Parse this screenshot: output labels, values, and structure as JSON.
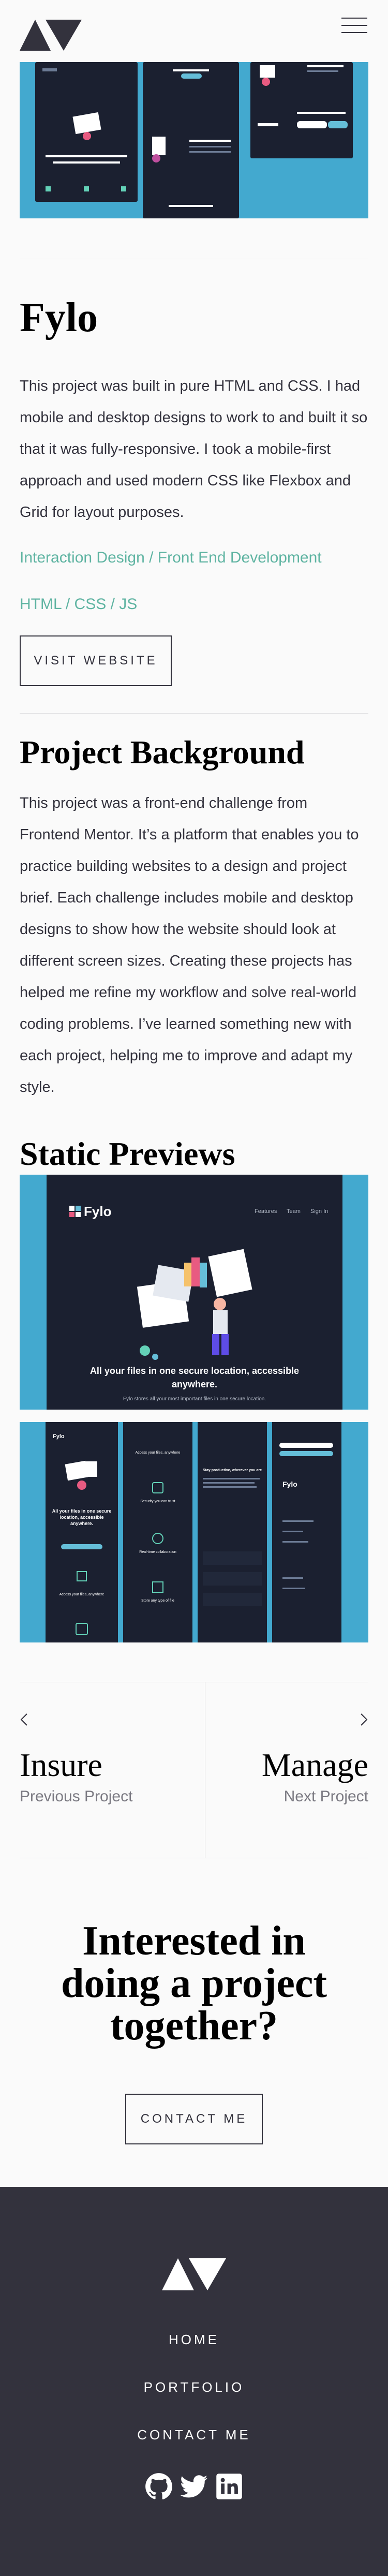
{
  "brand": {
    "logo_icon": "triangle-logo-icon"
  },
  "header": {
    "menu_icon": "hamburger-menu-icon"
  },
  "project": {
    "title": "Fylo",
    "summary": "This project was built in pure HTML and CSS. I had mobile and desktop designs to work to and built it so that it was fully-responsive. I took a mobile-first approach and used modern CSS like Flexbox and Grid for layout purposes.",
    "categories": "Interaction Design / Front End Development",
    "stack": "HTML / CSS / JS",
    "visit_label": "VISIT WEBSITE"
  },
  "background": {
    "heading": "Project Background",
    "text": "This project was a front-end challenge from Frontend Mentor. It’s a platform that enables you to practice building websites to a design and project brief. Each challenge includes mobile and desktop designs to show how the website should look at different screen sizes. Creating these projects has helped me refine my workflow and solve real-world coding problems. I’ve learned something new with each project, helping me to improve and adapt my style."
  },
  "previews": {
    "heading": "Static Previews",
    "desktop": {
      "logo": "Fylo",
      "nav": [
        "Features",
        "Team",
        "Sign In"
      ],
      "headline": "All your files in one secure location, accessible anywhere.",
      "subline": "Fylo stores all your most important files in one secure location."
    },
    "mobile": {
      "logo": "Fylo",
      "headline": "All your files in one secure location, accessible anywhere.",
      "features": [
        "Access your files, anywhere",
        "Security you can trust",
        "Real-time collaboration",
        "Store any type of file"
      ],
      "section": "Stay productive, wherever you are"
    }
  },
  "pager": {
    "prev": {
      "name": "Insure",
      "label": "Previous Project",
      "icon": "chevron-left-icon"
    },
    "next": {
      "name": "Manage",
      "label": "Next Project",
      "icon": "chevron-right-icon"
    }
  },
  "cta": {
    "heading": "Interested in doing a project together?",
    "button": "CONTACT ME"
  },
  "footer": {
    "links": [
      "HOME",
      "PORTFOLIO",
      "CONTACT ME"
    ],
    "social": [
      "github-icon",
      "twitter-icon",
      "linkedin-icon"
    ]
  },
  "colors": {
    "accent": "#5fb4a2",
    "dark": "#33323d",
    "preview_bg": "#43a9cf",
    "background": "#fafafa"
  }
}
